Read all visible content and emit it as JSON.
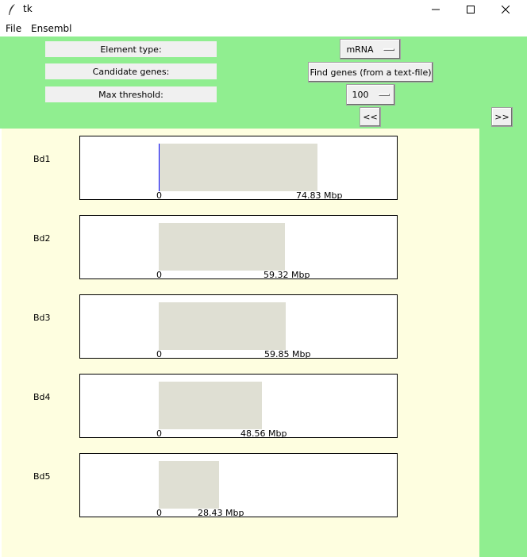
{
  "window": {
    "title": "tk"
  },
  "menu": {
    "items": [
      "File",
      "Ensembl"
    ]
  },
  "controls": {
    "element_type_label": "Element type:",
    "candidate_genes_label": "Candidate genes:",
    "max_threshold_label": "Max threshold:",
    "element_type_value": "mRNA",
    "find_genes_label": "Find genes (from a text-file)",
    "threshold_value": "100",
    "prev_label": "<<",
    "next_label": ">>"
  },
  "colors": {
    "control_bg": "#90ee90",
    "canvas_bg": "#fefee0",
    "bar": "#dfdfd3",
    "marker": "#0000ff"
  },
  "chromosomes": [
    {
      "name": "Bd1",
      "start_label": "0",
      "end_label": "74.83 Mbp",
      "length_mbp": 74.83,
      "marker": true
    },
    {
      "name": "Bd2",
      "start_label": "0",
      "end_label": "59.32 Mbp",
      "length_mbp": 59.32,
      "marker": false
    },
    {
      "name": "Bd3",
      "start_label": "0",
      "end_label": "59.85 Mbp",
      "length_mbp": 59.85,
      "marker": false
    },
    {
      "name": "Bd4",
      "start_label": "0",
      "end_label": "48.56 Mbp",
      "length_mbp": 48.56,
      "marker": false
    },
    {
      "name": "Bd5",
      "start_label": "0",
      "end_label": "28.43 Mbp",
      "length_mbp": 28.43,
      "marker": false
    }
  ]
}
